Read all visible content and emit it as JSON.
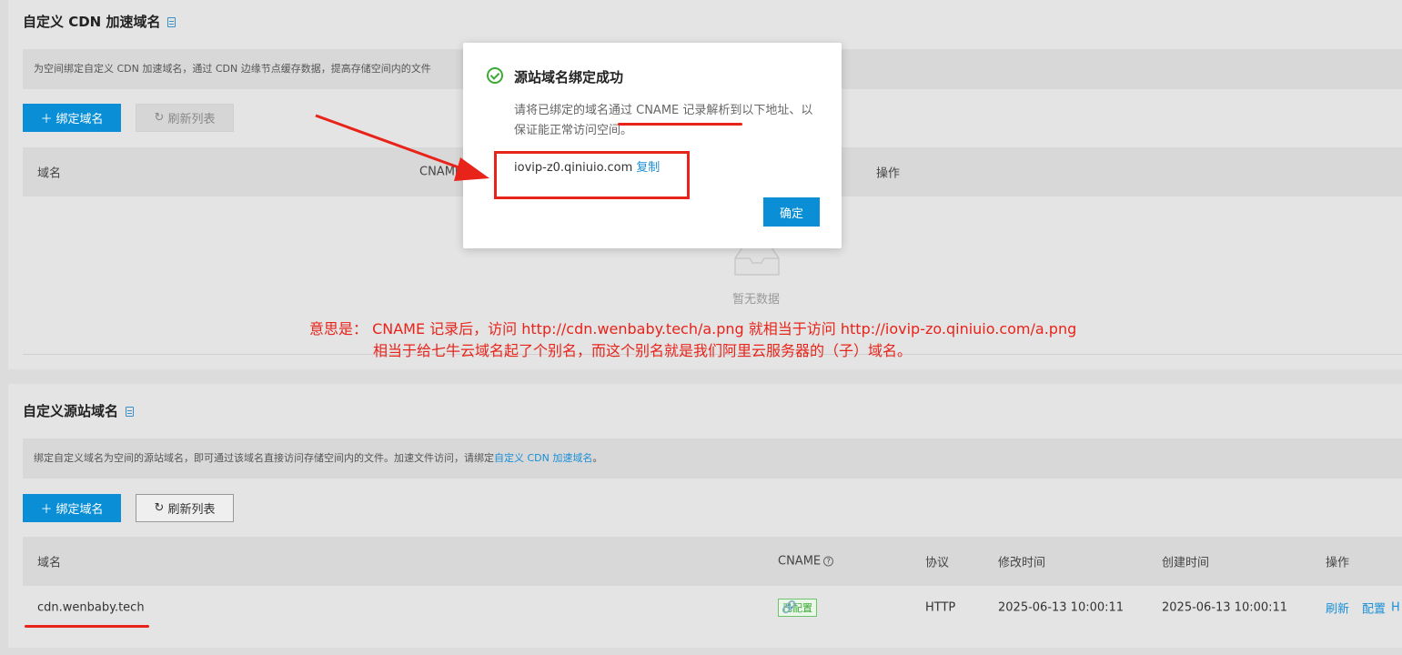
{
  "cdn_section": {
    "title": "自定义 CDN 加速域名",
    "desc": "为空间绑定自定义 CDN 加速域名，通过 CDN 边缘节点缓存数据，提高存储空间内的文件",
    "bind_btn": "绑定域名",
    "refresh_btn": "刷新列表",
    "headers": [
      "域名",
      "CNAME",
      "操作"
    ],
    "empty_text": "暂无数据"
  },
  "origin_section": {
    "title": "自定义源站域名",
    "desc_prefix": "绑定自定义域名为空间的源站域名，即可通过该域名直接访问存储空间内的文件。加速文件访问，请绑定",
    "desc_link": "自定义 CDN 加速域名",
    "desc_suffix": "。",
    "bind_btn": "绑定域名",
    "refresh_btn": "刷新列表",
    "headers": {
      "domain": "域名",
      "cname": "CNAME",
      "protocol": "协议",
      "modified": "修改时间",
      "created": "创建时间",
      "actions": "操作"
    },
    "row": {
      "domain": "cdn.wenbaby.tech",
      "badge": "已配置",
      "protocol": "HTTP",
      "modified": "2025-06-13 10:00:11",
      "created": "2025-06-13 10:00:11",
      "action_refresh": "刷新",
      "action_config": "配置",
      "action_more": "H"
    }
  },
  "modal": {
    "title": "源站域名绑定成功",
    "message": "请将已绑定的域名通过 CNAME 记录解析到以下地址、以保证能正常访问空间。",
    "cname_value": "iovip-z0.qiniuio.com",
    "copy_link": "复制",
    "ok_btn": "确定"
  },
  "annotation": {
    "line1": "意思是： CNAME 记录后，访问 http://cdn.wenbaby.tech/a.png 就相当于访问 http://iovip-zo.qiniuio.com/a.png",
    "line2": "相当于给七牛云域名起了个别名，而这个别名就是我们阿里云服务器的（子）域名。"
  },
  "colors": {
    "primary": "#0a8fd6",
    "annotation_red": "#e8231a",
    "success_green": "#3aaa35"
  }
}
